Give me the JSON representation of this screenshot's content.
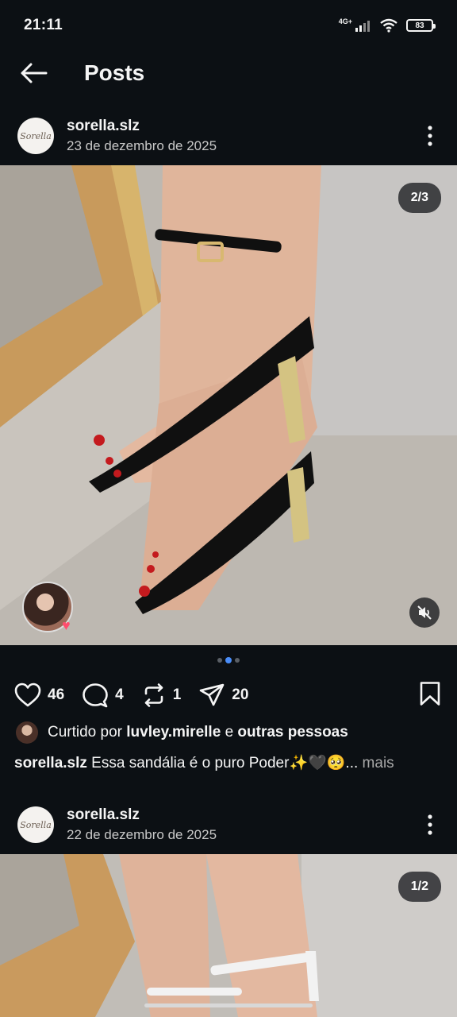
{
  "status_bar": {
    "time": "21:11",
    "network": "4G+",
    "battery": "83"
  },
  "top_bar": {
    "title": "Posts"
  },
  "posts": [
    {
      "avatar_text": "Sorella",
      "username": "sorella.slz",
      "date": "23 de dezembro de 2025",
      "media_counter": "2/3",
      "likes": "46",
      "comments": "4",
      "reposts": "1",
      "shares": "20",
      "liked_by_prefix": "Curtido por",
      "liked_by_user": "luvley.mirelle",
      "liked_by_joiner": "e",
      "liked_by_suffix": "outras pessoas",
      "caption_user": "sorella.slz",
      "caption_text": "Essa sandália é o puro Poder✨🖤🥺...",
      "caption_more": "mais"
    },
    {
      "avatar_text": "Sorella",
      "username": "sorella.slz",
      "date": "22 de dezembro de 2025",
      "media_counter": "1/2"
    }
  ],
  "icons": {
    "back": "arrow-left-icon",
    "more": "more-vertical-icon",
    "like": "heart-icon",
    "comment": "comment-bubble-icon",
    "repost": "repost-icon",
    "share": "send-icon",
    "save": "bookmark-icon",
    "mute": "speaker-muted-icon"
  },
  "colors": {
    "background": "#0c1014",
    "accent": "#4a8df8",
    "heart": "#ff4d6d"
  }
}
